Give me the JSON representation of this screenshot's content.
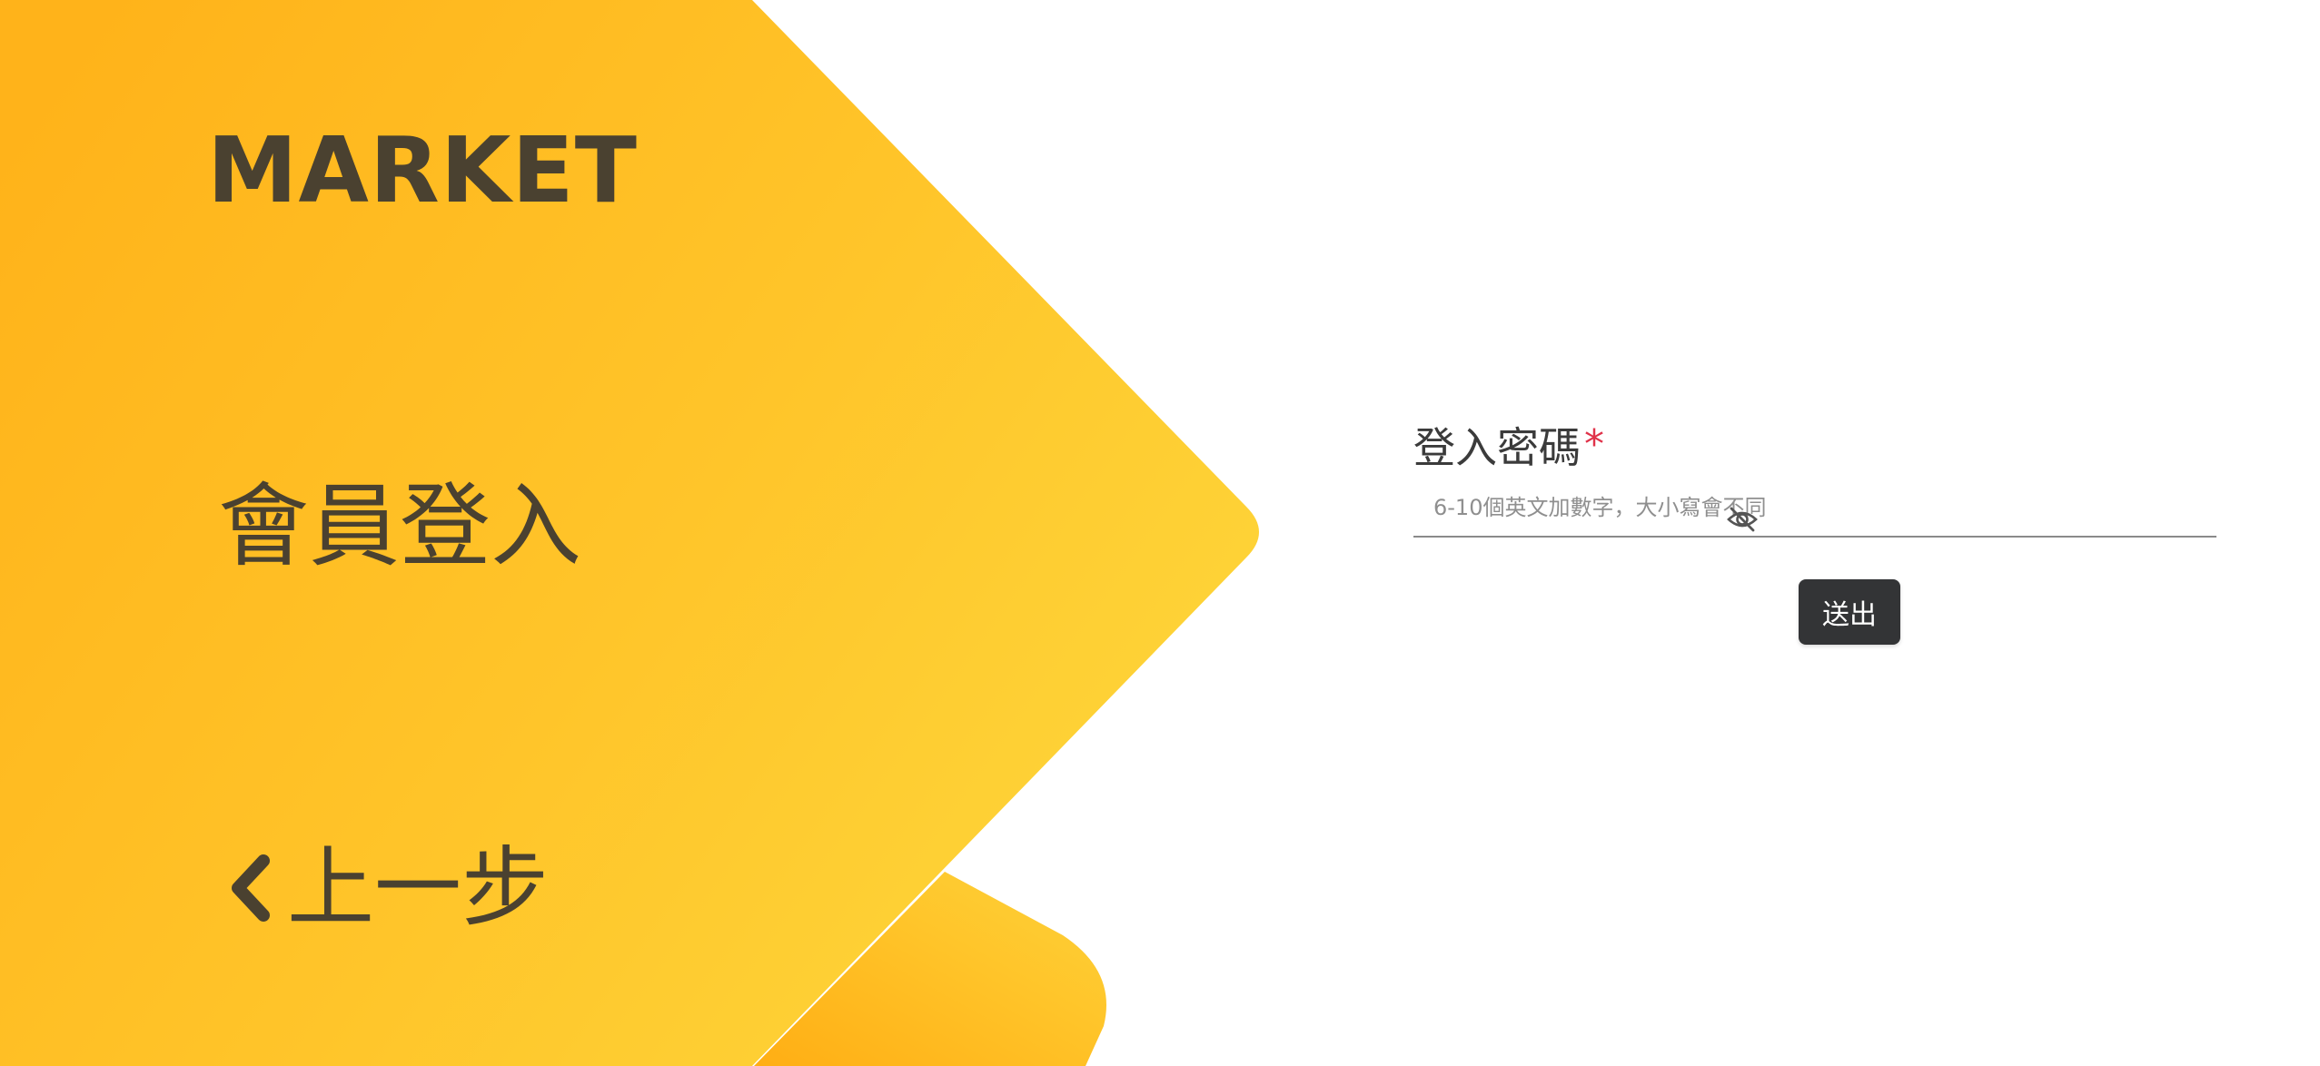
{
  "brand": {
    "title": "MARKET"
  },
  "page": {
    "heading": "會員登入"
  },
  "nav": {
    "back_label": "上一步",
    "back_icon": "chevron-left-icon"
  },
  "form": {
    "password_label": "登入密碼",
    "required_marker": "*",
    "password_placeholder": "6-10個英文加數字，大小寫會不同",
    "password_value": "",
    "visibility_icon": "eye-off-icon",
    "submit_label": "送出"
  },
  "colors": {
    "accent_yellow": "#ffc629",
    "accent_orange": "#ffb31a",
    "text_dark": "#4a4130",
    "required_red": "#e0334a",
    "button_dark": "#333436"
  }
}
